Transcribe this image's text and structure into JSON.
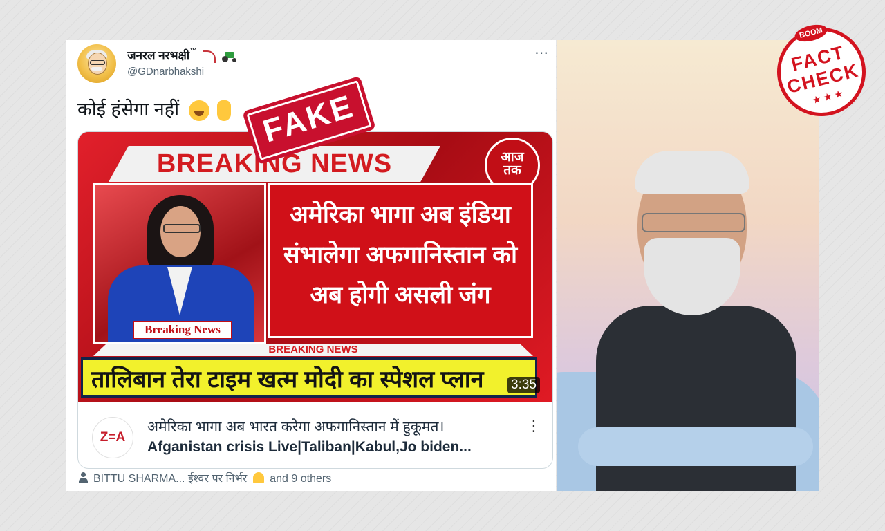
{
  "tweet": {
    "user_name": "जनरल नरभक्षी",
    "user_name_suffix": "™",
    "handle": "@GDnarbhakshi",
    "text": "कोई हंसेगा नहीं",
    "more_icon": "⋯"
  },
  "fake_stamp": "FAKE",
  "video": {
    "banner": "BREAKING NEWS",
    "channel_logo_text": "आज\nतक",
    "badge": "Breaking News",
    "headline_lines": [
      "अमेरिका भागा अब इंडिया",
      "संभालेगा अफगानिस्तान को",
      "अब होगी असली जंग"
    ],
    "strip": "BREAKING NEWS",
    "ticker": "तालिबान तेरा टाइम खत्म मोदी का स्पेशल प्लान",
    "duration": "3:35",
    "channel": "Z=A",
    "title_line1": "अमेरिका भागा अब भारत करेगा अफगानिस्तान में हुकूमत।",
    "title_line2": "Afganistan crisis Live|Taliban|Kabul,Jo biden...",
    "more_icon": "⋮"
  },
  "social": {
    "prefix": "BITTU SHARMA... ईश्वर पर निर्भर",
    "suffix": "and 9 others"
  },
  "badge": {
    "top": "BOOM",
    "line1": "FACT",
    "line2": "CHECK",
    "stars": "★ ★ ★"
  }
}
